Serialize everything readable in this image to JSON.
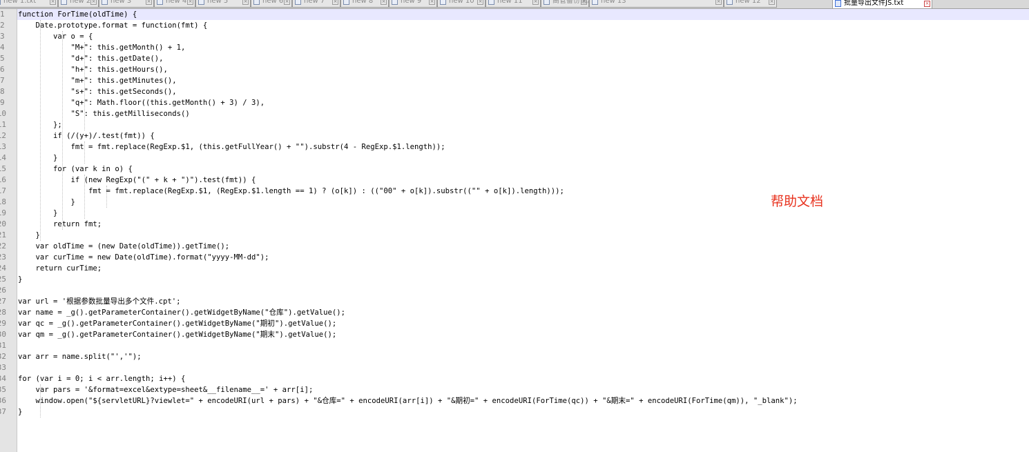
{
  "tabs": [
    {
      "label": "new 1.txt",
      "active": false
    },
    {
      "label": "new 2",
      "active": false
    },
    {
      "label": "new 3",
      "active": false
    },
    {
      "label": "new 4",
      "active": false
    },
    {
      "label": "new 5",
      "active": false
    },
    {
      "label": "new 6",
      "active": false
    },
    {
      "label": "new 7",
      "active": false
    },
    {
      "label": "new 8",
      "active": false
    },
    {
      "label": "new 9",
      "active": false
    },
    {
      "label": "new 10",
      "active": false
    },
    {
      "label": "new 11",
      "active": false
    },
    {
      "label": "高管备份信息批处理代码.txt",
      "active": false
    },
    {
      "label": "new 13",
      "active": false
    },
    {
      "label": "new 12",
      "active": false
    },
    {
      "label": "批量导出文件JS.txt",
      "active": true
    }
  ],
  "editor": {
    "current_line": 1,
    "lines": [
      "function ForTime(oldTime) {",
      "    Date.prototype.format = function(fmt) {",
      "        var o = {",
      "            \"M+\": this.getMonth() + 1,",
      "            \"d+\": this.getDate(),",
      "            \"h+\": this.getHours(),",
      "            \"m+\": this.getMinutes(),",
      "            \"s+\": this.getSeconds(),",
      "            \"q+\": Math.floor((this.getMonth() + 3) / 3),",
      "            \"S\": this.getMilliseconds()",
      "        };",
      "        if (/(y+)/.test(fmt)) {",
      "            fmt = fmt.replace(RegExp.$1, (this.getFullYear() + \"\").substr(4 - RegExp.$1.length));",
      "        }",
      "        for (var k in o) {",
      "            if (new RegExp(\"(\" + k + \")\").test(fmt)) {",
      "                fmt = fmt.replace(RegExp.$1, (RegExp.$1.length == 1) ? (o[k]) : ((\"00\" + o[k]).substr((\"\" + o[k]).length)));",
      "            }",
      "        }",
      "        return fmt;",
      "    }",
      "    var oldTime = (new Date(oldTime)).getTime();",
      "    var curTime = new Date(oldTime).format(\"yyyy-MM-dd\");",
      "    return curTime;",
      "}",
      "",
      "var url = '根据参数批量导出多个文件.cpt';",
      "var name = _g().getParameterContainer().getWidgetByName(\"仓库\").getValue();",
      "var qc = _g().getParameterContainer().getWidgetByName(\"期初\").getValue();",
      "var qm = _g().getParameterContainer().getWidgetByName(\"期末\").getValue();",
      "",
      "var arr = name.split(\"','\");",
      "",
      "for (var i = 0; i < arr.length; i++) {",
      "    var pars = '&format=excel&extype=sheet&__filename__=' + arr[i];",
      "    window.open(\"${servletURL}?viewlet=\" + encodeURI(url + pars) + \"&仓库=\" + encodeURI(arr[i]) + \"&期初=\" + encodeURI(ForTime(qc)) + \"&期末=\" + encodeURI(ForTime(qm)), \"_blank\");",
      "}"
    ]
  },
  "annotation": {
    "text": "帮助文档",
    "color": "#e8321e"
  },
  "colors": {
    "tabbar_bg": "#d8d8d8",
    "active_tab_accent": "#f5a623",
    "gutter_bg": "#e4e4e4",
    "line_number": "#808080",
    "current_line_highlight": "#e8e8ff",
    "code_text": "#000000"
  },
  "icons": {
    "tab_file": "file-icon",
    "tab_close": "close-icon"
  }
}
